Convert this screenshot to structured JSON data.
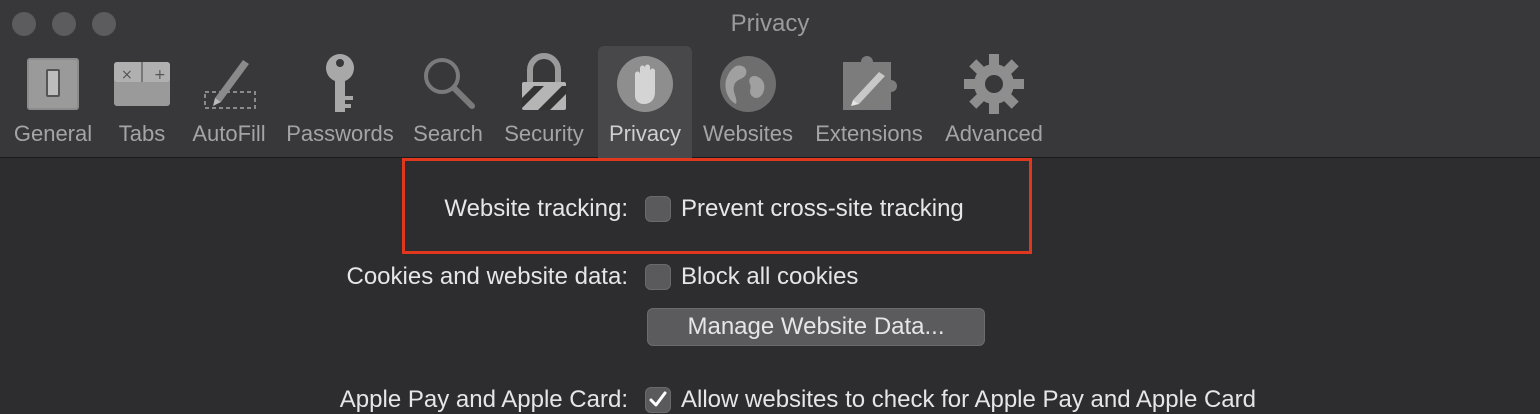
{
  "window": {
    "title": "Privacy"
  },
  "toolbar": {
    "tabs": [
      {
        "label": "General",
        "icon": "general-switch-icon"
      },
      {
        "label": "Tabs",
        "icon": "tabs-icon"
      },
      {
        "label": "AutoFill",
        "icon": "pencil-icon"
      },
      {
        "label": "Passwords",
        "icon": "key-icon"
      },
      {
        "label": "Search",
        "icon": "magnifier-icon"
      },
      {
        "label": "Security",
        "icon": "lock-icon"
      },
      {
        "label": "Privacy",
        "icon": "hand-icon",
        "selected": true
      },
      {
        "label": "Websites",
        "icon": "globe-icon"
      },
      {
        "label": "Extensions",
        "icon": "puzzle-icon"
      },
      {
        "label": "Advanced",
        "icon": "gear-icon"
      }
    ]
  },
  "settings": {
    "website_tracking": {
      "label": "Website tracking:",
      "option": "Prevent cross-site tracking",
      "checked": false
    },
    "cookies": {
      "label": "Cookies and website data:",
      "option": "Block all cookies",
      "checked": false,
      "button": "Manage Website Data..."
    },
    "apple_pay": {
      "label": "Apple Pay and Apple Card:",
      "option": "Allow websites to check for Apple Pay and Apple Card",
      "checked": true
    }
  },
  "colors": {
    "highlight": "#e0371f",
    "background": "#2d2d30",
    "toolbar": "#38383b"
  }
}
